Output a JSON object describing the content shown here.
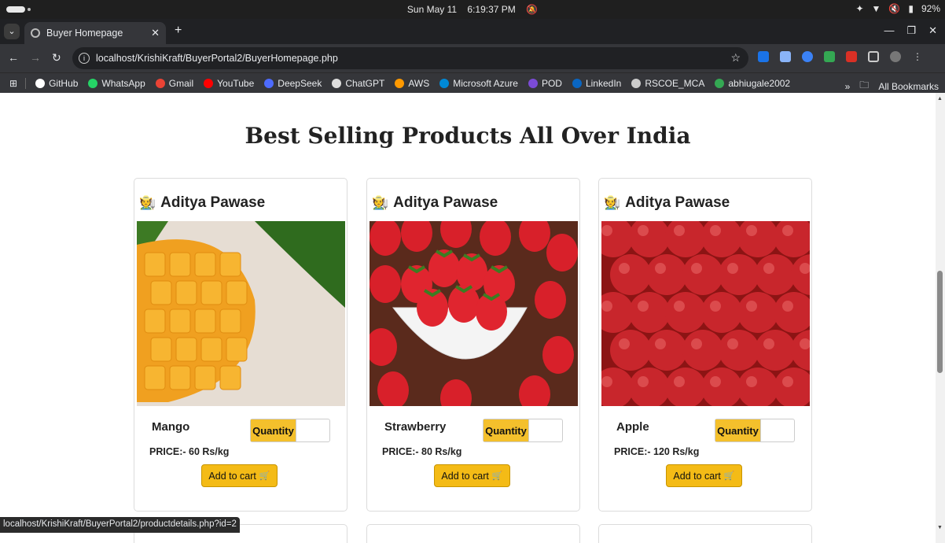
{
  "system": {
    "date": "Sun May 11",
    "time": "6:19:37 PM",
    "battery": "92%"
  },
  "browser": {
    "tab_title": "Buyer Homepage",
    "url": "localhost/KrishiKraft/BuyerPortal2/BuyerHomepage.php",
    "bookmarks": [
      {
        "label": "GitHub",
        "icon": "github-icon",
        "color": "#ffffff"
      },
      {
        "label": "WhatsApp",
        "icon": "whatsapp-icon",
        "color": "#25d366"
      },
      {
        "label": "Gmail",
        "icon": "gmail-icon",
        "color": "#ea4335"
      },
      {
        "label": "YouTube",
        "icon": "youtube-icon",
        "color": "#ff0000"
      },
      {
        "label": "DeepSeek",
        "icon": "deepseek-icon",
        "color": "#4d6bfe"
      },
      {
        "label": "ChatGPT",
        "icon": "chatgpt-icon",
        "color": "#dddddd"
      },
      {
        "label": "AWS",
        "icon": "aws-icon",
        "color": "#ff9900"
      },
      {
        "label": "Microsoft Azure",
        "icon": "azure-icon",
        "color": "#0089d6"
      },
      {
        "label": "POD",
        "icon": "pod-icon",
        "color": "#7b4bd6"
      },
      {
        "label": "LinkedIn",
        "icon": "linkedin-icon",
        "color": "#0a66c2"
      },
      {
        "label": "RSCOE_MCA",
        "icon": "globe-icon",
        "color": "#cccccc"
      },
      {
        "label": "abhiugale2002",
        "icon": "drive-icon",
        "color": "#34a853"
      }
    ],
    "all_bookmarks": "All Bookmarks",
    "status_url": "localhost/KrishiKraft/BuyerPortal2/productdetails.php?id=2"
  },
  "page": {
    "heading": "Best Selling Products All Over India",
    "products": [
      {
        "seller": "Aditya Pawase",
        "name": "Mango",
        "price": "PRICE:- 60 Rs/kg",
        "quantity_label": "Quantity",
        "cart_label": "Add to cart"
      },
      {
        "seller": "Aditya Pawase",
        "name": "Strawberry",
        "price": "PRICE:- 80 Rs/kg",
        "quantity_label": "Quantity",
        "cart_label": "Add to cart"
      },
      {
        "seller": "Aditya Pawase",
        "name": "Apple",
        "price": "PRICE:- 120 Rs/kg",
        "quantity_label": "Quantity",
        "cart_label": "Add to cart"
      }
    ]
  },
  "colors": {
    "accent": "#f4bb16",
    "quantity_label_bg": "#f4c02c"
  }
}
